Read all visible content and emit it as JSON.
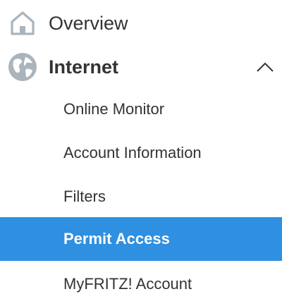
{
  "nav": {
    "overview": {
      "label": "Overview",
      "icon": "home-icon"
    },
    "internet": {
      "label": "Internet",
      "icon": "globe-icon",
      "expanded_icon": "chevron-up-icon",
      "items": [
        {
          "label": "Online Monitor"
        },
        {
          "label": "Account Information"
        },
        {
          "label": "Filters"
        },
        {
          "label": "Permit Access",
          "active": true
        },
        {
          "label": "MyFRITZ! Account"
        }
      ]
    }
  },
  "colors": {
    "active_bg": "#2f8fe0",
    "text": "#333333",
    "icon": "#aab4bd"
  }
}
